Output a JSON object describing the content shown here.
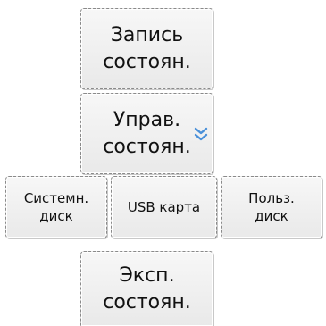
{
  "buttons": {
    "record_state": {
      "line1": "Запись",
      "line2": "состоян."
    },
    "control_state": {
      "line1": "Управ.",
      "line2": "состоян."
    },
    "system_disk": {
      "line1": "Системн.",
      "line2": "диск"
    },
    "usb_card": {
      "label": "USB карта"
    },
    "user_disk": {
      "line1": "Польз.",
      "line2": "диск"
    },
    "export_state": {
      "line1": "Эксп.",
      "line2": "состоян."
    }
  },
  "colors": {
    "chevron": "#4a90d9"
  },
  "icons": {
    "control_state": "chevron-double-down-icon"
  }
}
